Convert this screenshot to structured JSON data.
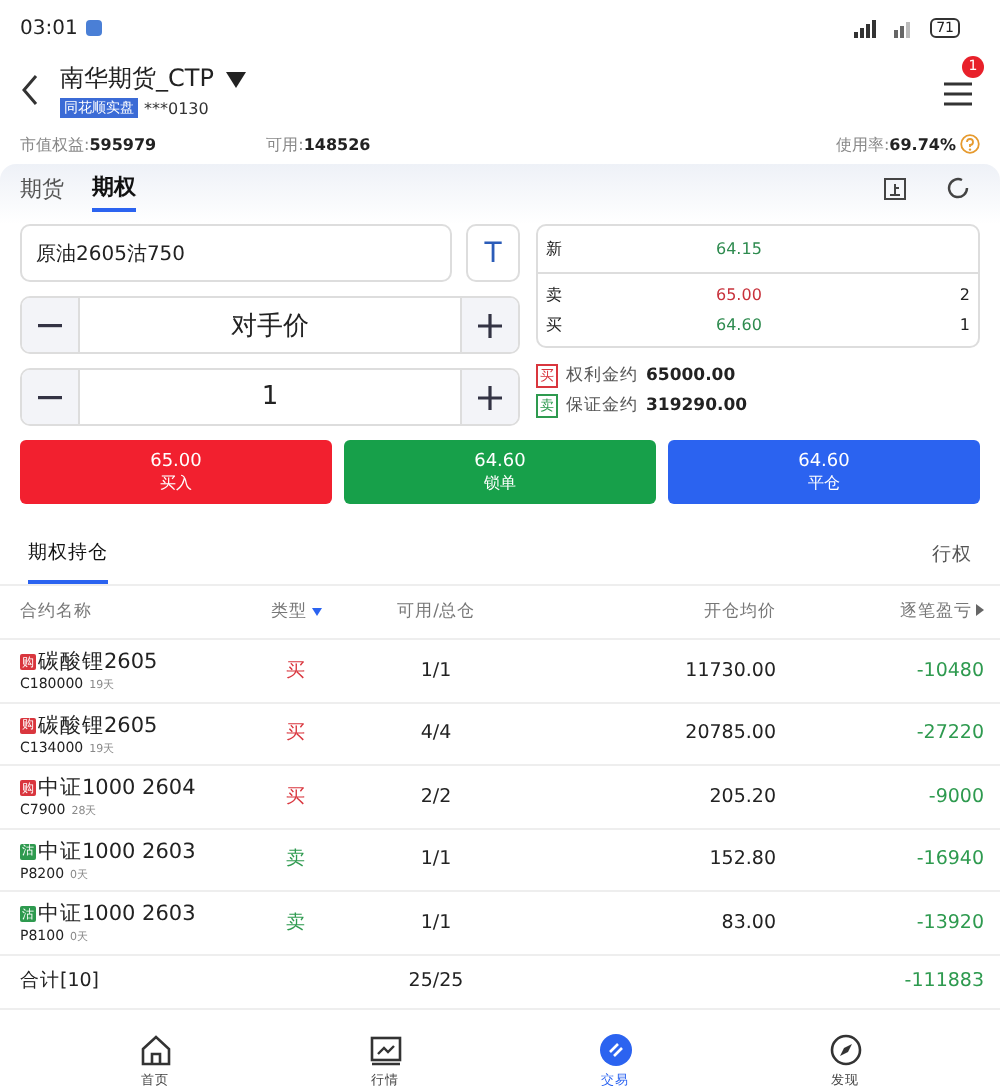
{
  "status_bar": {
    "time": "03:01",
    "battery": "71"
  },
  "header": {
    "title": "南华期货_CTP",
    "tag": "同花顺实盘",
    "account": "***0130",
    "badge": "1"
  },
  "summary": [
    {
      "label": "市值权益:",
      "value": "595979"
    },
    {
      "label": "可用:",
      "value": "148526"
    },
    {
      "label": "使用率:",
      "value": "69.74%"
    }
  ],
  "tabs": [
    {
      "label": "期货",
      "selected": false
    },
    {
      "label": "期权",
      "selected": true
    }
  ],
  "order": {
    "contract": "原油2605沽750",
    "t_button": "T",
    "price_mode": "对手价",
    "quantity": "1"
  },
  "quote": [
    {
      "label": "新",
      "price": "64.15",
      "color": "#2e8b4f"
    },
    {
      "label": "卖",
      "price": "65.00",
      "volume": "2",
      "color": "#c8323c"
    },
    {
      "label": "买",
      "price": "64.60",
      "volume": "1",
      "color": "#2e8b4f"
    }
  ],
  "margins": [
    {
      "tag": "买",
      "label": "权利金约",
      "value": "65000.00",
      "kind": "buy"
    },
    {
      "tag": "卖",
      "label": "保证金约",
      "value": "319290.00",
      "kind": "sell"
    }
  ],
  "actions": [
    {
      "price": "65.00",
      "label": "买入",
      "kind": "buy"
    },
    {
      "price": "64.60",
      "label": "锁单",
      "kind": "lock"
    },
    {
      "price": "64.60",
      "label": "平仓",
      "kind": "close"
    }
  ],
  "position_tabs": [
    {
      "label": "期权持仓",
      "selected": true
    },
    {
      "label": "行权",
      "selected": false
    }
  ],
  "columns": [
    "合约名称",
    "类型",
    "可用/总仓",
    "开仓均价",
    "逐笔盈亏"
  ],
  "rows": [
    {
      "badge": "购",
      "kind": "call",
      "name": "碳酸锂2605",
      "strike": "C180000",
      "days": "19天",
      "type": "买",
      "color": "#d9363e",
      "avail": "1/1",
      "avg": "11730.00",
      "pnl": "-10480"
    },
    {
      "badge": "购",
      "kind": "call",
      "name": "碳酸锂2605",
      "strike": "C134000",
      "days": "19天",
      "type": "买",
      "color": "#d9363e",
      "avail": "4/4",
      "avg": "20785.00",
      "pnl": "-27220"
    },
    {
      "badge": "购",
      "kind": "call",
      "name": "中证1000 2604",
      "strike": "C7900",
      "days": "28天",
      "type": "买",
      "color": "#d9363e",
      "avail": "2/2",
      "avg": "205.20",
      "pnl": "-9000"
    },
    {
      "badge": "沽",
      "kind": "put",
      "name": "中证1000 2603",
      "strike": "P8200",
      "days": "0天",
      "type": "卖",
      "color": "#2e9a4f",
      "avail": "1/1",
      "avg": "152.80",
      "pnl": "-16940"
    },
    {
      "badge": "沽",
      "kind": "put",
      "name": "中证1000 2603",
      "strike": "P8100",
      "days": "0天",
      "type": "卖",
      "color": "#2e9a4f",
      "avail": "1/1",
      "avg": "83.00",
      "pnl": "-13920"
    }
  ],
  "total": {
    "label": "合计[10]",
    "avail": "25/25",
    "pnl": "-111883"
  },
  "nav": [
    {
      "label": "首页",
      "kind": "home",
      "selected": false
    },
    {
      "label": "行情",
      "kind": "chart",
      "selected": false
    },
    {
      "label": "交易",
      "kind": "trade",
      "selected": true
    },
    {
      "label": "发现",
      "kind": "compass",
      "selected": false
    }
  ]
}
